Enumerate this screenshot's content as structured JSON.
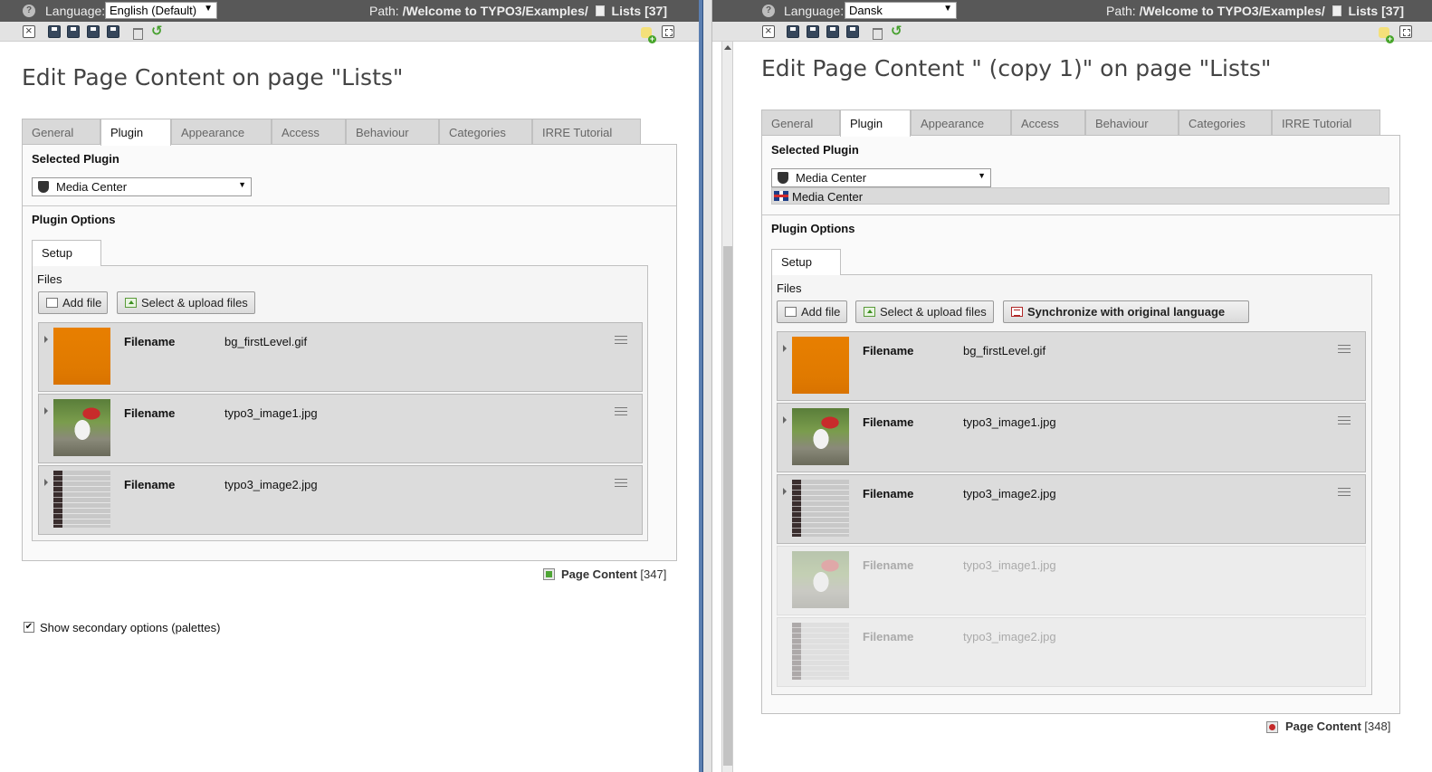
{
  "left": {
    "language_label": "Language:",
    "language_value": "English (Default)",
    "path_label": "Path:",
    "path_value": "/Welcome to TYPO3/Examples/",
    "page_ref": "Lists [37]",
    "title": "Edit Page Content on page \"Lists\"",
    "tabs": [
      "General",
      "Plugin",
      "Appearance",
      "Access",
      "Behaviour",
      "Categories",
      "IRRE Tutorial"
    ],
    "active_tab": "Plugin",
    "selected_plugin_heading": "Selected Plugin",
    "plugin_value": "Media Center",
    "plugin_options_heading": "Plugin Options",
    "setup_tab": "Setup",
    "files_label": "Files",
    "add_file": "Add file",
    "select_upload": "Select & upload files",
    "files": [
      {
        "label": "Filename",
        "value": "bg_firstLevel.gif",
        "thumb": "orange"
      },
      {
        "label": "Filename",
        "value": "typo3_image1.jpg",
        "thumb": "dog"
      },
      {
        "label": "Filename",
        "value": "typo3_image2.jpg",
        "thumb": "code"
      }
    ],
    "footer_record": "Page Content",
    "footer_id": "[347]",
    "secondary_options": "Show secondary options (palettes)",
    "secondary_checked": true
  },
  "right": {
    "language_label": "Language:",
    "language_value": "Dansk",
    "path_label": "Path:",
    "path_value": "/Welcome to TYPO3/Examples/",
    "page_ref": "Lists [37]",
    "title": "Edit Page Content \" (copy 1)\" on page \"Lists\"",
    "tabs": [
      "General",
      "Plugin",
      "Appearance",
      "Access",
      "Behaviour",
      "Categories",
      "IRRE Tutorial"
    ],
    "active_tab": "Plugin",
    "selected_plugin_heading": "Selected Plugin",
    "plugin_value": "Media Center",
    "default_language_value": "Media Center",
    "plugin_options_heading": "Plugin Options",
    "setup_tab": "Setup",
    "files_label": "Files",
    "add_file": "Add file",
    "select_upload": "Select & upload files",
    "synchronize": "Synchronize with original language",
    "files": [
      {
        "label": "Filename",
        "value": "bg_firstLevel.gif",
        "thumb": "orange"
      },
      {
        "label": "Filename",
        "value": "typo3_image1.jpg",
        "thumb": "dog"
      },
      {
        "label": "Filename",
        "value": "typo3_image2.jpg",
        "thumb": "code"
      }
    ],
    "ghost_files": [
      {
        "label": "Filename",
        "value": "typo3_image1.jpg",
        "thumb": "dog"
      },
      {
        "label": "Filename",
        "value": "typo3_image2.jpg",
        "thumb": "code"
      }
    ],
    "footer_record": "Page Content",
    "footer_id": "[348]"
  },
  "colors": {
    "topbar": "#585858",
    "divider": "#5b7fb1",
    "tab_inactive": "#d9d9d9",
    "file_row": "#dcdcdc"
  }
}
